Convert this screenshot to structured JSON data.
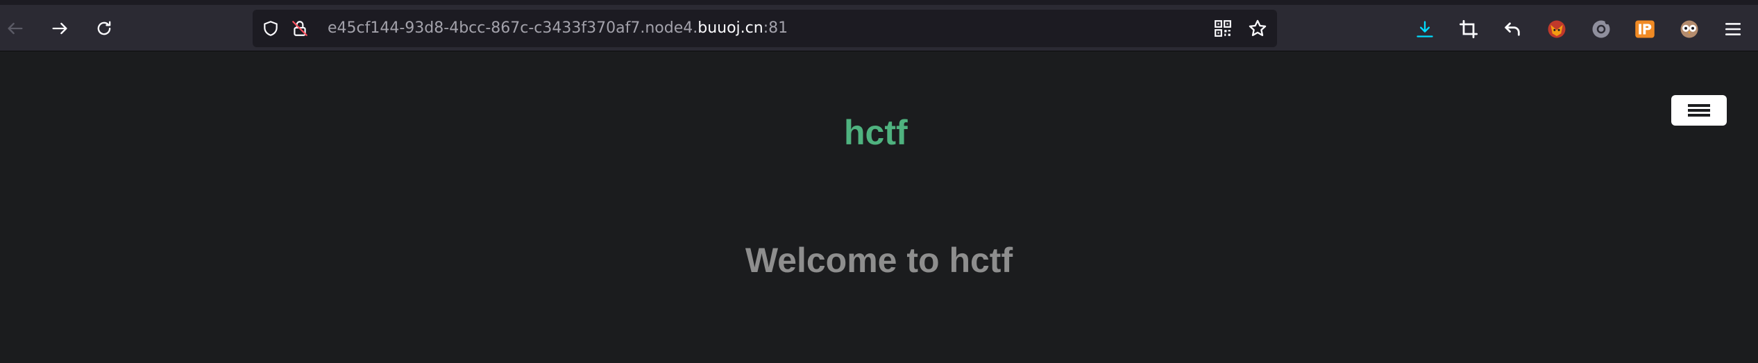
{
  "browser": {
    "url_prefix": "e45cf144-93d8-4bcc-867c-c3433f370af7.node4.",
    "url_host": "buuoj.cn",
    "url_suffix": ":81",
    "icons": {
      "back": "back-arrow-icon",
      "forward": "forward-arrow-icon",
      "reload": "reload-icon",
      "tracking": "shield-icon",
      "insecure": "insecure-lock-icon",
      "qr": "qr-code-icon",
      "bookmark": "star-icon",
      "downloads": "download-icon",
      "screenshot": "crop-icon",
      "undo": "undo-icon",
      "ext1": "fox-extension-icon",
      "ext2": "gear-extension-icon",
      "ext3": "ip-extension-icon",
      "ext4": "owl-extension-icon",
      "menu": "app-menu-icon"
    },
    "colors": {
      "toolbar": "#2b2a33",
      "urlbar": "#1c1b22",
      "download_accent": "#00ddff"
    }
  },
  "page": {
    "brand": "hctf",
    "heading": "Welcome to hctf",
    "nav_toggle_icon": "hamburger-menu-icon",
    "colors": {
      "background": "#1b1c1e",
      "brand": "#4fb27f",
      "heading": "#8e8e8e"
    }
  }
}
